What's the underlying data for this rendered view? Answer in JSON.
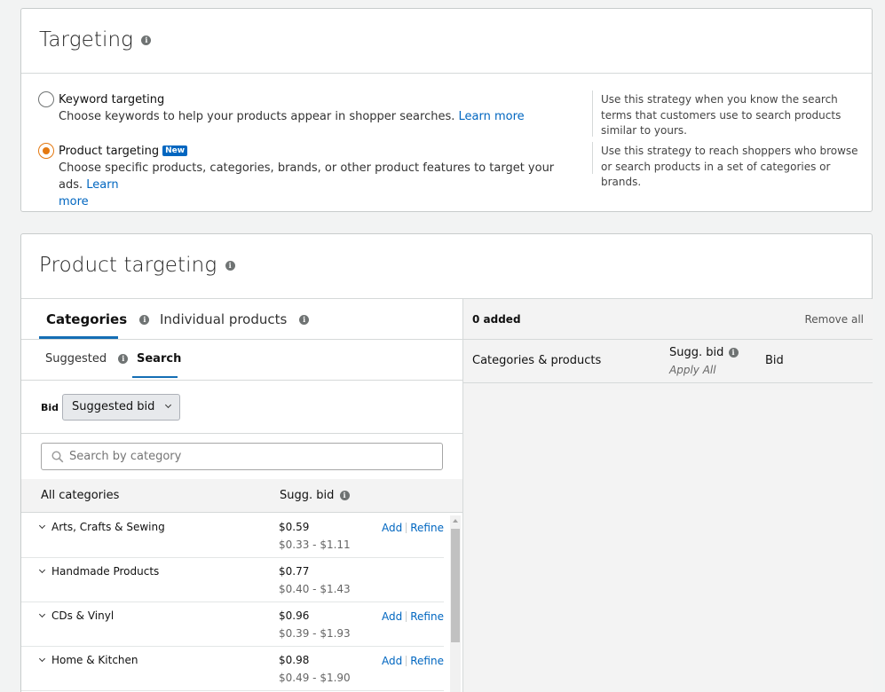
{
  "targeting": {
    "title": "Targeting",
    "options": [
      {
        "label": "Keyword targeting",
        "description": "Choose keywords to help your products appear in shopper searches.",
        "link": "Learn more",
        "help": "Use this strategy when you know the search terms that customers use to search products similar to yours.",
        "checked": false
      },
      {
        "label": "Product targeting",
        "badge": "New",
        "description": "Choose specific products, categories, brands, or other product features to target your ads.",
        "link_part1": "Learn",
        "link_part2": "more",
        "help": "Use this strategy to reach shoppers who browse or search products in a set of categories or brands.",
        "checked": true
      }
    ]
  },
  "product_targeting": {
    "title": "Product targeting",
    "tabs": [
      {
        "label": "Categories",
        "active": true
      },
      {
        "label": "Individual products",
        "active": false
      }
    ],
    "subtabs": [
      {
        "label": "Suggested",
        "active": false
      },
      {
        "label": "Search",
        "active": true
      }
    ],
    "bid_label": "Bid",
    "bid_dropdown": "Suggested bid",
    "search_placeholder": "Search by category",
    "table_headers": {
      "category": "All categories",
      "sugg_bid": "Sugg. bid"
    },
    "rows": [
      {
        "name": "Arts, Crafts & Sewing",
        "bid": "$0.59",
        "range": "$0.33 - $1.11",
        "add": "Add",
        "refine": "Refine",
        "has_actions": true
      },
      {
        "name": "Handmade Products",
        "bid": "$0.77",
        "range": "$0.40 - $1.43",
        "has_actions": false
      },
      {
        "name": "CDs & Vinyl",
        "bid": "$0.96",
        "range": "$0.39 - $1.93",
        "add": "Add",
        "refine": "Refine",
        "has_actions": true
      },
      {
        "name": "Home & Kitchen",
        "bid": "$0.98",
        "range": "$0.49 - $1.90",
        "add": "Add",
        "refine": "Refine",
        "has_actions": true
      }
    ],
    "right_panel": {
      "added": "0 added",
      "remove_all": "Remove all",
      "col_categories": "Categories & products",
      "col_sugg_bid": "Sugg. bid",
      "apply_all": "Apply All",
      "col_bid": "Bid"
    }
  },
  "colors": {
    "accent": "#e47911",
    "link": "#0066c0",
    "tab_underline": "#146eb4"
  }
}
